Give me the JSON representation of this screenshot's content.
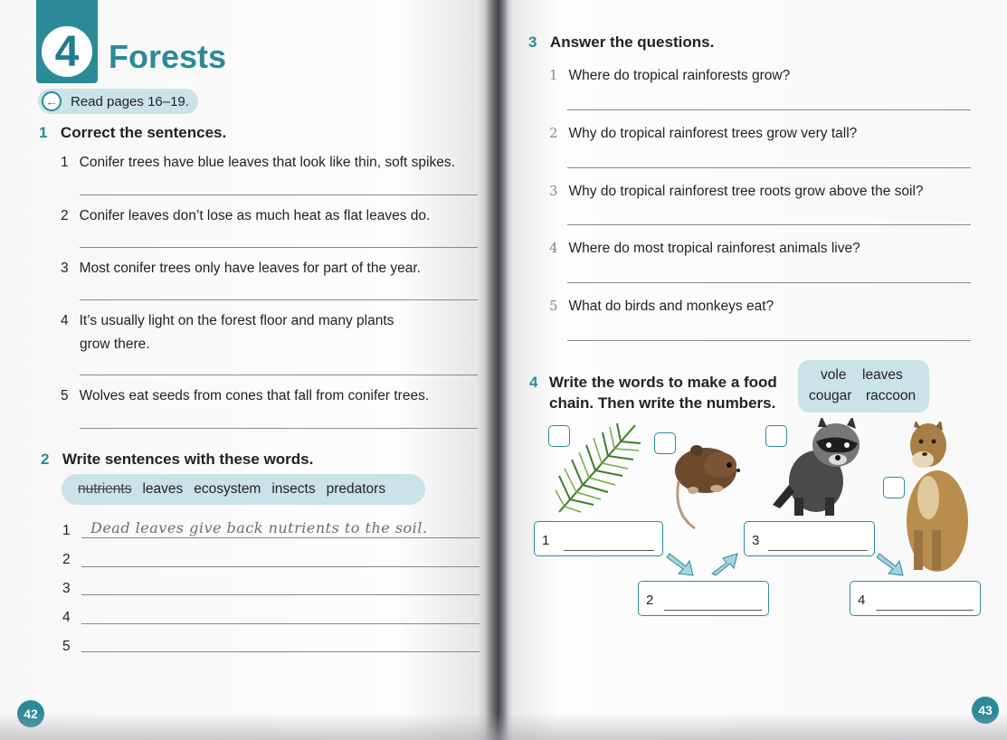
{
  "left_page": {
    "chapter_number": "4",
    "chapter_title": "Forests",
    "read_pages": "Read pages 16–19.",
    "ex1": {
      "number": "1",
      "title": "Correct the sentences.",
      "items": [
        {
          "num": "1",
          "text": "Conifer trees have blue leaves that look like thin, soft spikes."
        },
        {
          "num": "2",
          "text": "Conifer leaves don’t lose as much heat as flat leaves do."
        },
        {
          "num": "3",
          "text": "Most conifer trees only have leaves for part of the year."
        },
        {
          "num": "4",
          "text": "It’s usually light on the forest floor and many plants",
          "text2": "grow there."
        },
        {
          "num": "5",
          "text": "Wolves eat seeds from cones that fall from conifer trees."
        }
      ]
    },
    "ex2": {
      "number": "2",
      "title": "Write sentences with these words.",
      "words": [
        "nutrients",
        "leaves",
        "ecosystem",
        "insects",
        "predators"
      ],
      "lines": [
        {
          "num": "1",
          "answer": "Dead leaves give back nutrients to the soil."
        },
        {
          "num": "2",
          "answer": ""
        },
        {
          "num": "3",
          "answer": ""
        },
        {
          "num": "4",
          "answer": ""
        },
        {
          "num": "5",
          "answer": ""
        }
      ]
    },
    "page_number": "42"
  },
  "right_page": {
    "ex3": {
      "number": "3",
      "title": "Answer the questions.",
      "questions": [
        {
          "num": "1",
          "text": "Where do tropical rainforests grow?"
        },
        {
          "num": "2",
          "text": "Why do tropical rainforest trees grow very tall?"
        },
        {
          "num": "3",
          "text": "Why do tropical rainforest tree roots grow above the soil?"
        },
        {
          "num": "4",
          "text": "Where do most tropical rainforest animals live?"
        },
        {
          "num": "5",
          "text": "What do birds and monkeys eat?"
        }
      ]
    },
    "ex4": {
      "number": "4",
      "title_line1": "Write the words to make a food",
      "title_line2": "chain. Then write the numbers.",
      "words": [
        "vole",
        "leaves",
        "cougar",
        "raccoon"
      ],
      "boxes": [
        "1",
        "2",
        "3",
        "4"
      ]
    },
    "page_number": "43"
  },
  "colors": {
    "accent": "#2c8a98",
    "wordbank": "#c9e3e8"
  }
}
